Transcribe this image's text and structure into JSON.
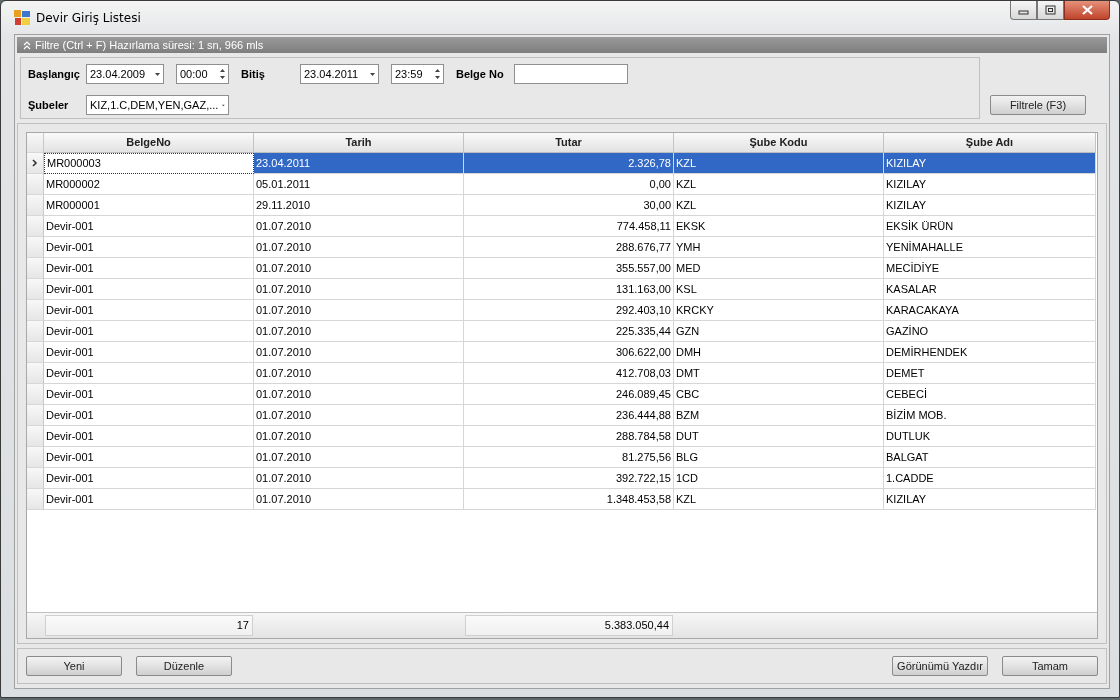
{
  "window": {
    "title": "Devir Giriş Listesi"
  },
  "filter": {
    "header": "Filtre (Ctrl + F) Hazırlama süresi: 1 sn, 966 mls",
    "expanded": true,
    "start_label": "Başlangıç",
    "start_date": "23.04.2009",
    "start_time": "00:00",
    "end_label": "Bitiş",
    "end_date": "23.04.2011",
    "end_time": "23:59",
    "doc_label": "Belge No",
    "branches_label": "Şubeler",
    "branches": "KIZ,1.C,DEM,YEN,GAZ,...",
    "filter_button": "Filtrele (F3)"
  },
  "table": {
    "columns": [
      {
        "label": "BelgeNo",
        "kind": "text"
      },
      {
        "label": "Tarih",
        "kind": "text"
      },
      {
        "label": "Tutar",
        "kind": "number"
      },
      {
        "label": "Şube Kodu",
        "kind": "text"
      },
      {
        "label": "Şube Adı",
        "kind": "text"
      }
    ],
    "rows": [
      {
        "cells": [
          "MR000003",
          "23.04.2011",
          "2.326,78",
          "KZL",
          "KIZILAY"
        ],
        "selected": true
      },
      {
        "cells": [
          "MR000002",
          "05.01.2011",
          "0,00",
          "KZL",
          "KIZILAY"
        ],
        "selected": false
      },
      {
        "cells": [
          "MR000001",
          "29.11.2010",
          "30,00",
          "KZL",
          "KIZILAY"
        ],
        "selected": false
      },
      {
        "cells": [
          "Devir-001",
          "01.07.2010",
          "774.458,11",
          "EKSK",
          "EKSİK ÜRÜN"
        ],
        "selected": false
      },
      {
        "cells": [
          "Devir-001",
          "01.07.2010",
          "288.676,77",
          "YMH",
          "YENİMAHALLE"
        ],
        "selected": false
      },
      {
        "cells": [
          "Devir-001",
          "01.07.2010",
          "355.557,00",
          "MED",
          "MECİDİYE"
        ],
        "selected": false
      },
      {
        "cells": [
          "Devir-001",
          "01.07.2010",
          "131.163,00",
          "KSL",
          "KASALAR"
        ],
        "selected": false
      },
      {
        "cells": [
          "Devir-001",
          "01.07.2010",
          "292.403,10",
          "KRCKY",
          "KARACAKAYA"
        ],
        "selected": false
      },
      {
        "cells": [
          "Devir-001",
          "01.07.2010",
          "225.335,44",
          "GZN",
          "GAZİNO"
        ],
        "selected": false
      },
      {
        "cells": [
          "Devir-001",
          "01.07.2010",
          "306.622,00",
          "DMH",
          "DEMİRHENDEK"
        ],
        "selected": false
      },
      {
        "cells": [
          "Devir-001",
          "01.07.2010",
          "412.708,03",
          "DMT",
          "DEMET"
        ],
        "selected": false
      },
      {
        "cells": [
          "Devir-001",
          "01.07.2010",
          "246.089,45",
          "CBC",
          "CEBECİ"
        ],
        "selected": false
      },
      {
        "cells": [
          "Devir-001",
          "01.07.2010",
          "236.444,88",
          "BZM",
          "BİZİM MOB."
        ],
        "selected": false
      },
      {
        "cells": [
          "Devir-001",
          "01.07.2010",
          "288.784,58",
          "DUT",
          "DUTLUK"
        ],
        "selected": false
      },
      {
        "cells": [
          "Devir-001",
          "01.07.2010",
          "81.275,56",
          "BLG",
          "BALGAT"
        ],
        "selected": false
      },
      {
        "cells": [
          "Devir-001",
          "01.07.2010",
          "392.722,15",
          "1CD",
          "1.CADDE"
        ],
        "selected": false
      },
      {
        "cells": [
          "Devir-001",
          "01.07.2010",
          "1.348.453,58",
          "KZL",
          "KIZILAY"
        ],
        "selected": false
      }
    ],
    "footer": {
      "belge_no": "17",
      "tutar": "5.383.050,44"
    }
  },
  "buttons_left": [
    "Yeni",
    "Düzenle"
  ],
  "buttons_right": [
    "Görünümü Yazdır",
    "Tamam"
  ]
}
